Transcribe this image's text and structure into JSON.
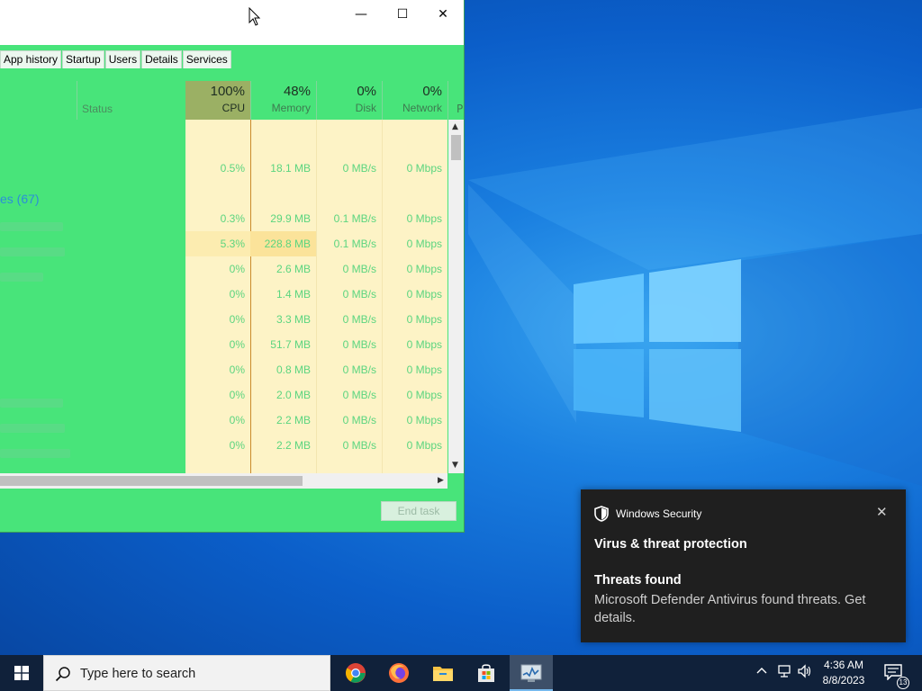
{
  "task_manager": {
    "tabs": [
      "App history",
      "Startup",
      "Users",
      "Details",
      "Services"
    ],
    "columns": {
      "status": "Status",
      "cpu": {
        "pct": "100%",
        "label": "CPU"
      },
      "memory": {
        "pct": "48%",
        "label": "Memory"
      },
      "disk": {
        "pct": "0%",
        "label": "Disk"
      },
      "network": {
        "pct": "0%",
        "label": "Network"
      },
      "truncated": "P"
    },
    "group_label": "es (67)",
    "rows": [
      {
        "cpu": "",
        "memory": "",
        "disk": "",
        "network": ""
      },
      {
        "cpu": "0.5%",
        "memory": "18.1 MB",
        "disk": "0 MB/s",
        "network": "0 Mbps"
      },
      {
        "cpu": "",
        "memory": "",
        "disk": "",
        "network": ""
      },
      {
        "cpu": "0.3%",
        "memory": "29.9 MB",
        "disk": "0.1 MB/s",
        "network": "0 Mbps"
      },
      {
        "cpu": "5.3%",
        "memory": "228.8 MB",
        "disk": "0.1 MB/s",
        "network": "0 Mbps"
      },
      {
        "cpu": "0%",
        "memory": "2.6 MB",
        "disk": "0 MB/s",
        "network": "0 Mbps"
      },
      {
        "cpu": "0%",
        "memory": "1.4 MB",
        "disk": "0 MB/s",
        "network": "0 Mbps"
      },
      {
        "cpu": "0%",
        "memory": "3.3 MB",
        "disk": "0 MB/s",
        "network": "0 Mbps"
      },
      {
        "cpu": "0%",
        "memory": "51.7 MB",
        "disk": "0 MB/s",
        "network": "0 Mbps"
      },
      {
        "cpu": "0%",
        "memory": "0.8 MB",
        "disk": "0 MB/s",
        "network": "0 Mbps"
      },
      {
        "cpu": "0%",
        "memory": "2.0 MB",
        "disk": "0 MB/s",
        "network": "0 Mbps"
      },
      {
        "cpu": "0%",
        "memory": "2.2 MB",
        "disk": "0 MB/s",
        "network": "0 Mbps"
      },
      {
        "cpu": "0%",
        "memory": "2.2 MB",
        "disk": "0 MB/s",
        "network": "0 Mbps"
      }
    ],
    "end_task": "End task",
    "window_buttons": {
      "minimize": "—",
      "maximize": "☐",
      "close": "✕"
    }
  },
  "toast": {
    "app": "Windows Security",
    "title": "Virus & threat protection",
    "subtitle": "Threats found",
    "body": "Microsoft Defender Antivirus found threats. Get details.",
    "close": "✕"
  },
  "taskbar": {
    "search_placeholder": "Type here to search",
    "apps": [
      "chrome-icon",
      "firefox-icon",
      "file-explorer-icon",
      "store-icon",
      "task-manager-icon"
    ],
    "tray": {
      "chevron": "^",
      "time": "4:36 AM",
      "date": "8/8/2023",
      "notifications": "13"
    }
  },
  "colors": {
    "tm_bg": "#48e47a",
    "toast_bg": "#1f1f1f",
    "taskbar_bg": "#10213a",
    "highlight": "#fdf3c6"
  }
}
